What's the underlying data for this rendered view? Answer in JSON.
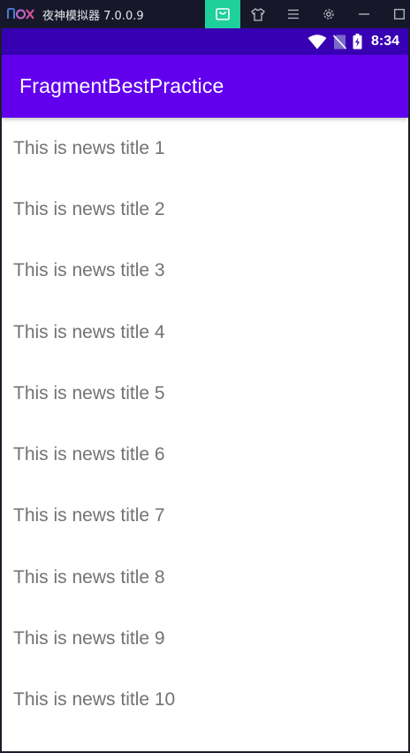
{
  "emulator": {
    "title": "夜神模拟器 7.0.0.9",
    "controls": [
      "bag-icon",
      "shirt-icon",
      "menu-icon",
      "gear-icon",
      "minimize-icon",
      "maximize-icon",
      "close-icon"
    ],
    "accent": "#1fcf9c"
  },
  "status_bar": {
    "time": "8:34",
    "color": "#3700b3"
  },
  "app_bar": {
    "title": "FragmentBestPractice",
    "color": "#6200ee"
  },
  "news": {
    "items": [
      "This is news title 1",
      "This is news title 2",
      "This is news title 3",
      "This is news title 4",
      "This is news title 5",
      "This is news title 6",
      "This is news title 7",
      "This is news title 8",
      "This is news title 9",
      "This is news title 10"
    ]
  }
}
